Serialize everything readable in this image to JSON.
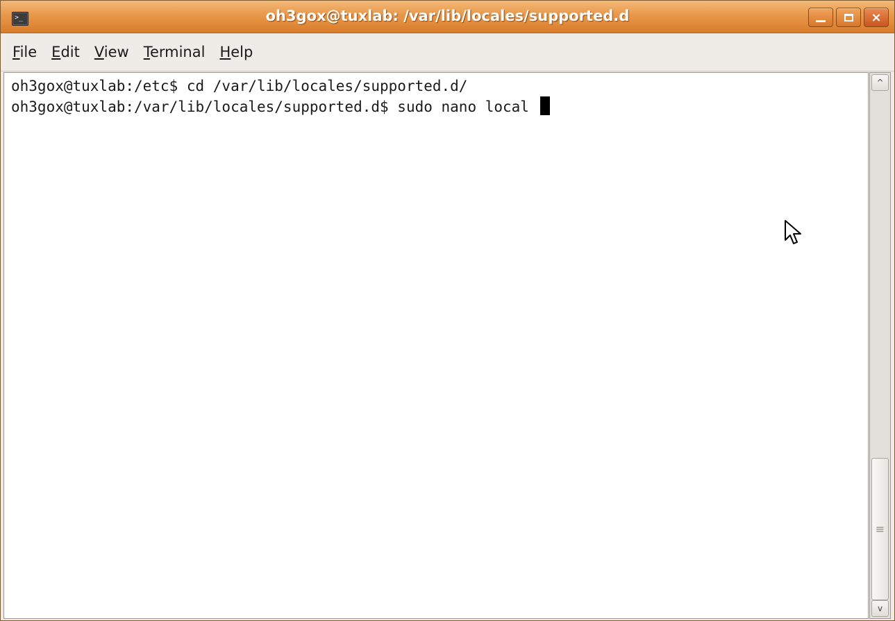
{
  "window": {
    "title": "oh3gox@tuxlab: /var/lib/locales/supported.d",
    "app_icon_glyph": ">_",
    "buttons": {
      "close_glyph": "×"
    }
  },
  "menubar": {
    "items": [
      {
        "mnemonic": "F",
        "rest": "ile"
      },
      {
        "mnemonic": "E",
        "rest": "dit"
      },
      {
        "mnemonic": "V",
        "rest": "iew"
      },
      {
        "mnemonic": "T",
        "rest": "erminal"
      },
      {
        "mnemonic": "H",
        "rest": "elp"
      }
    ]
  },
  "terminal": {
    "lines": [
      "oh3gox@tuxlab:/etc$ cd /var/lib/locales/supported.d/",
      "oh3gox@tuxlab:/var/lib/locales/supported.d$ sudo nano local "
    ]
  },
  "scrollbar": {
    "up_glyph": "^",
    "down_glyph": "v",
    "grip_glyph": "≡",
    "thumb_fraction": 0.28
  },
  "colors": {
    "titlebar": "#e8984a",
    "terminal_bg": "#ffffff",
    "terminal_fg": "#1a1a1a"
  }
}
